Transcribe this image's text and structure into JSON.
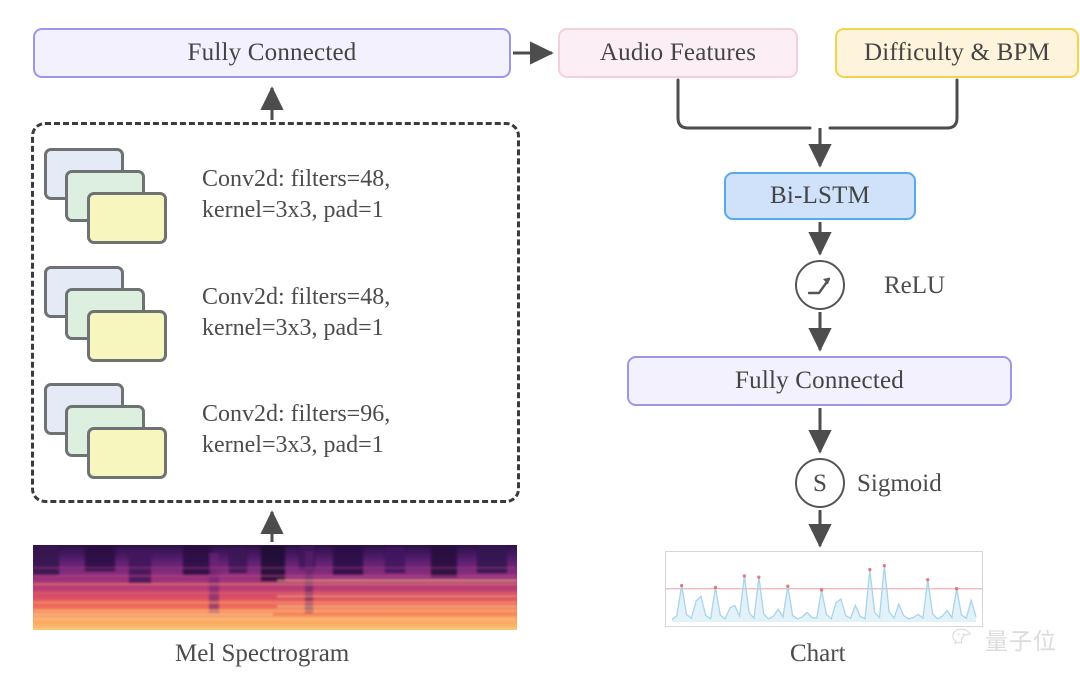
{
  "diagram": {
    "title": "Neural network architecture: CNN audio encoder with Bi-LSTM chart decoder",
    "nodes": {
      "fc_left": "Fully Connected",
      "fc_right": "Fully Connected",
      "audio_features": "Audio Features",
      "difficulty_bpm": "Difficulty & BPM",
      "bilstm": "Bi-LSTM",
      "sigmoid_glyph": "S"
    },
    "activations": {
      "relu": "ReLU",
      "sigmoid": "Sigmoid"
    },
    "conv_blocks": [
      {
        "line1": "Conv2d: filters=48,",
        "line2": "kernel=3x3, pad=1"
      },
      {
        "line1": "Conv2d: filters=48,",
        "line2": "kernel=3x3, pad=1"
      },
      {
        "line1": "Conv2d: filters=96,",
        "line2": "kernel=3x3, pad=1"
      }
    ],
    "captions": {
      "mel_spectrogram": "Mel Spectrogram",
      "chart": "Chart"
    },
    "watermark": {
      "text": "量子位",
      "icon": "wechat-icon"
    },
    "colors": {
      "fc_fill": "#f3f1fd",
      "fc_border": "#9b96e6",
      "audio_fill": "#fbeef4",
      "audio_border": "#f3cfdf",
      "difficulty_fill": "#fdf4db",
      "difficulty_border": "#f2d24e",
      "bilstm_fill": "#cfe2fa",
      "bilstm_border": "#5aa9ea",
      "card_blue": "#e4eaf6",
      "card_green": "#ddf0df",
      "card_yellow": "#f8f6bf",
      "card_border": "#6f7272",
      "dashed_border": "#3b3b3b",
      "arrow": "#4d4d4d",
      "chart_line": "#a8d4ec",
      "chart_threshold": "#f4b8b8",
      "chart_peak_dot": "#e06060",
      "text": "#4c4c4c"
    }
  },
  "chart_data": {
    "type": "line",
    "title": "Chart",
    "xlabel": "",
    "ylabel": "",
    "grid": false,
    "legend": null,
    "threshold": 0.52,
    "ylim": [
      0,
      1
    ],
    "x": [
      0,
      1,
      2,
      3,
      4,
      5,
      6,
      7,
      8,
      9,
      10,
      11,
      12,
      13,
      14,
      15,
      16,
      17,
      18,
      19,
      20,
      21,
      22,
      23,
      24,
      25,
      26,
      27,
      28,
      29,
      30,
      31,
      32,
      33,
      34,
      35,
      36,
      37,
      38,
      39,
      40,
      41,
      42,
      43,
      44,
      45,
      46,
      47,
      48,
      49,
      50,
      51,
      52,
      53,
      54,
      55,
      56,
      57,
      58,
      59,
      60,
      61,
      62,
      63
    ],
    "values": [
      0.04,
      0.1,
      0.57,
      0.12,
      0.06,
      0.33,
      0.4,
      0.1,
      0.05,
      0.54,
      0.11,
      0.05,
      0.22,
      0.26,
      0.09,
      0.72,
      0.14,
      0.06,
      0.7,
      0.13,
      0.05,
      0.09,
      0.2,
      0.08,
      0.56,
      0.1,
      0.05,
      0.08,
      0.15,
      0.07,
      0.06,
      0.5,
      0.12,
      0.05,
      0.3,
      0.36,
      0.1,
      0.06,
      0.26,
      0.09,
      0.05,
      0.82,
      0.15,
      0.07,
      0.88,
      0.16,
      0.06,
      0.28,
      0.1,
      0.05,
      0.07,
      0.12,
      0.06,
      0.66,
      0.13,
      0.05,
      0.09,
      0.18,
      0.07,
      0.52,
      0.11,
      0.06,
      0.34,
      0.08
    ],
    "peaks": [
      2,
      9,
      15,
      18,
      24,
      31,
      41,
      44,
      53,
      59
    ]
  }
}
